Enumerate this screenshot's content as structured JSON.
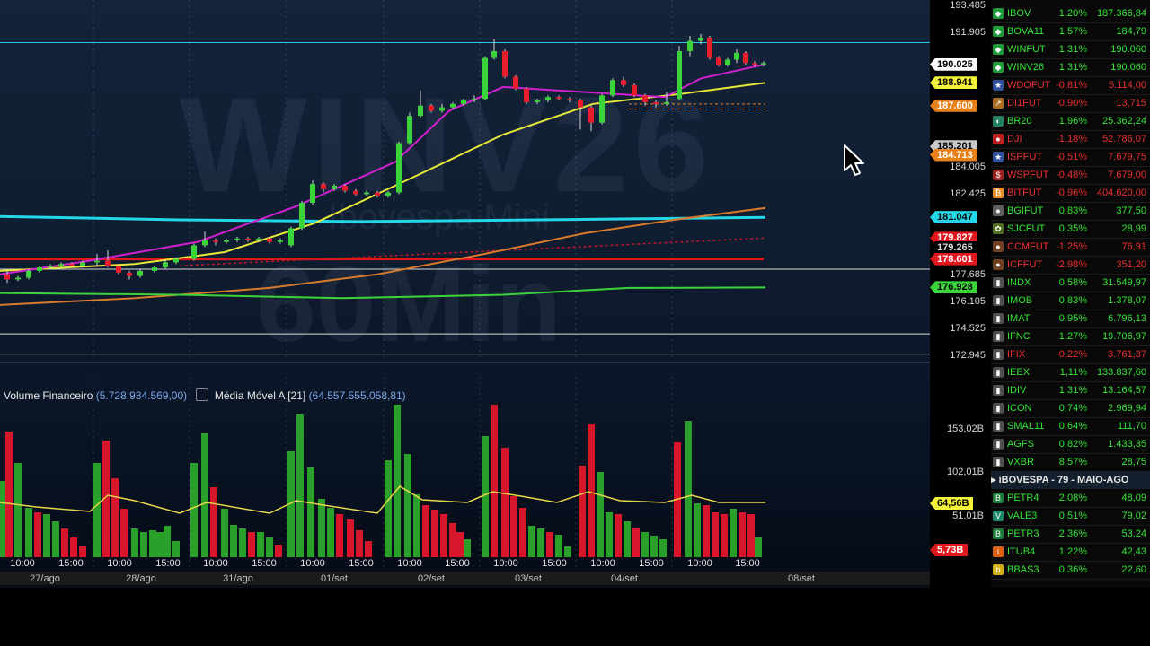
{
  "watermark": {
    "symbol": "WINV26",
    "name": "Ibovespa Mini",
    "timeframe": "60Min"
  },
  "price_axis": {
    "labels": [
      "193.485",
      "191.905",
      "184.005",
      "182.425",
      "177.685",
      "176.105",
      "174.525",
      "172.945"
    ],
    "tags": [
      {
        "value": "190.025",
        "color": "#ffffff",
        "text_color": "#000000"
      },
      {
        "value": "188.941",
        "color": "#f2f23a",
        "text_color": "#000000"
      },
      {
        "value": "187.600",
        "color": "#e8801a",
        "text_color": "#ffffff"
      },
      {
        "value": "185.201",
        "color": "#c8c8c8",
        "text_color": "#000000"
      },
      {
        "value": "184.713",
        "color": "#e8801a",
        "text_color": "#ffffff"
      },
      {
        "value": "181.047",
        "color": "#24d6e8",
        "text_color": "#000000"
      },
      {
        "value": "179.827",
        "color": "#e0181e",
        "text_color": "#ffffff"
      },
      {
        "value": "179.265",
        "color": "#000000",
        "text_color": "#d8d8d8"
      },
      {
        "value": "178.601",
        "color": "#e0181e",
        "text_color": "#ffffff"
      },
      {
        "value": "176.928",
        "color": "#3ad43a",
        "text_color": "#000000"
      }
    ]
  },
  "volume": {
    "title": "Volume Financeiro",
    "value": "(5.728.934.569,00)",
    "ma_title": "Média Móvel A [21]",
    "ma_value": "(64.557.555.058,81)",
    "axis_labels": [
      "153,02B",
      "102,01B",
      "51,01B"
    ],
    "tags": [
      {
        "value": "64,56B",
        "color": "#f2f23a",
        "text_color": "#000000"
      },
      {
        "value": "5,73B",
        "color": "#e0181e",
        "text_color": "#ffffff"
      }
    ]
  },
  "time_axis": {
    "times": [
      "10:00",
      "15:00",
      "10:00",
      "15:00",
      "10:00",
      "15:00",
      "10:00",
      "15:00",
      "10:00",
      "15:00",
      "10:00",
      "15:00",
      "10:00",
      "15:00",
      "10:00",
      "15:00"
    ],
    "dates": [
      "27/ago",
      "28/ago",
      "31/ago",
      "01/set",
      "02/set",
      "03/set",
      "04/set",
      "08/set"
    ]
  },
  "watchlist": {
    "rows": [
      {
        "icon": "br-flag",
        "sym": "IBOV",
        "pct": "1,20%",
        "price": "187.366,84",
        "color": "#34e634"
      },
      {
        "icon": "br-flag",
        "sym": "BOVA11",
        "pct": "1,57%",
        "price": "184,79",
        "color": "#34e634"
      },
      {
        "icon": "br-flag",
        "sym": "WINFUT",
        "pct": "1,31%",
        "price": "190.060",
        "color": "#34e634"
      },
      {
        "icon": "br-flag",
        "sym": "WINV26",
        "pct": "1,31%",
        "price": "190.060",
        "color": "#34e634"
      },
      {
        "icon": "us-flag",
        "sym": "WDOFUT",
        "pct": "-0,81%",
        "price": "5.114,00",
        "color": "#f03030"
      },
      {
        "icon": "chart-icon",
        "sym": "DI1FUT",
        "pct": "-0,90%",
        "price": "13,715",
        "color": "#f03030"
      },
      {
        "icon": "cow-icon",
        "sym": "BR20",
        "pct": "1,96%",
        "price": "25.362,24",
        "color": "#34e634"
      },
      {
        "icon": "dji-icon",
        "sym": "DJI",
        "pct": "-1,18%",
        "price": "52.786,07",
        "color": "#f03030"
      },
      {
        "icon": "us-flag",
        "sym": "ISPFUT",
        "pct": "-0,51%",
        "price": "7.679,75",
        "color": "#f03030"
      },
      {
        "icon": "sp500-icon",
        "sym": "WSPFUT",
        "pct": "-0,48%",
        "price": "7.679,00",
        "color": "#f03030"
      },
      {
        "icon": "bitcoin-icon",
        "sym": "BITFUT",
        "pct": "-0,96%",
        "price": "404.620,00",
        "color": "#f03030"
      },
      {
        "icon": "cattle-icon",
        "sym": "BGIFUT",
        "pct": "0,83%",
        "price": "377,50",
        "color": "#34e634"
      },
      {
        "icon": "soy-icon",
        "sym": "SJCFUT",
        "pct": "0,35%",
        "price": "28,99",
        "color": "#34e634"
      },
      {
        "icon": "coffee-icon",
        "sym": "CCMFUT",
        "pct": "-1,25%",
        "price": "76,91",
        "color": "#f03030"
      },
      {
        "icon": "coffee-icon",
        "sym": "ICFFUT",
        "pct": "-2,98%",
        "price": "351,20",
        "color": "#f03030"
      },
      {
        "icon": "index-icon",
        "sym": "INDX",
        "pct": "0,58%",
        "price": "31.549,97",
        "color": "#34e634"
      },
      {
        "icon": "index-icon",
        "sym": "IMOB",
        "pct": "0,83%",
        "price": "1.378,07",
        "color": "#34e634"
      },
      {
        "icon": "index-icon",
        "sym": "IMAT",
        "pct": "0,95%",
        "price": "6.796,13",
        "color": "#34e634"
      },
      {
        "icon": "index-icon",
        "sym": "IFNC",
        "pct": "1,27%",
        "price": "19.706,97",
        "color": "#34e634"
      },
      {
        "icon": "index-icon",
        "sym": "IFIX",
        "pct": "-0,22%",
        "price": "3.761,37",
        "color": "#f03030"
      },
      {
        "icon": "index-icon",
        "sym": "IEEX",
        "pct": "1,11%",
        "price": "133.837,60",
        "color": "#34e634"
      },
      {
        "icon": "index-icon",
        "sym": "IDIV",
        "pct": "1,31%",
        "price": "13.164,57",
        "color": "#34e634"
      },
      {
        "icon": "index-icon",
        "sym": "ICON",
        "pct": "0,74%",
        "price": "2.969,94",
        "color": "#34e634"
      },
      {
        "icon": "index-icon",
        "sym": "SMAL11",
        "pct": "0,64%",
        "price": "111,70",
        "color": "#34e634"
      },
      {
        "icon": "index-icon",
        "sym": "AGFS",
        "pct": "0,82%",
        "price": "1.433,35",
        "color": "#34e634"
      },
      {
        "icon": "index-icon",
        "sym": "VXBR",
        "pct": "8,57%",
        "price": "28,75",
        "color": "#34e634"
      }
    ],
    "group_label": "iBOVESPA - 79 - MAIO-AGO",
    "group_rows": [
      {
        "icon": "br-stock-icon",
        "sym": "PETR4",
        "pct": "2,08%",
        "price": "48,09",
        "color": "#34e634"
      },
      {
        "icon": "vale-icon",
        "sym": "VALE3",
        "pct": "0,51%",
        "price": "79,02",
        "color": "#34e634"
      },
      {
        "icon": "br-stock-icon",
        "sym": "PETR3",
        "pct": "2,36%",
        "price": "53,24",
        "color": "#34e634"
      },
      {
        "icon": "itau-icon",
        "sym": "ITUB4",
        "pct": "1,22%",
        "price": "42,43",
        "color": "#34e634"
      },
      {
        "icon": "bb-icon",
        "sym": "BBAS3",
        "pct": "0,36%",
        "price": "22,60",
        "color": "#34e634"
      }
    ]
  }
}
